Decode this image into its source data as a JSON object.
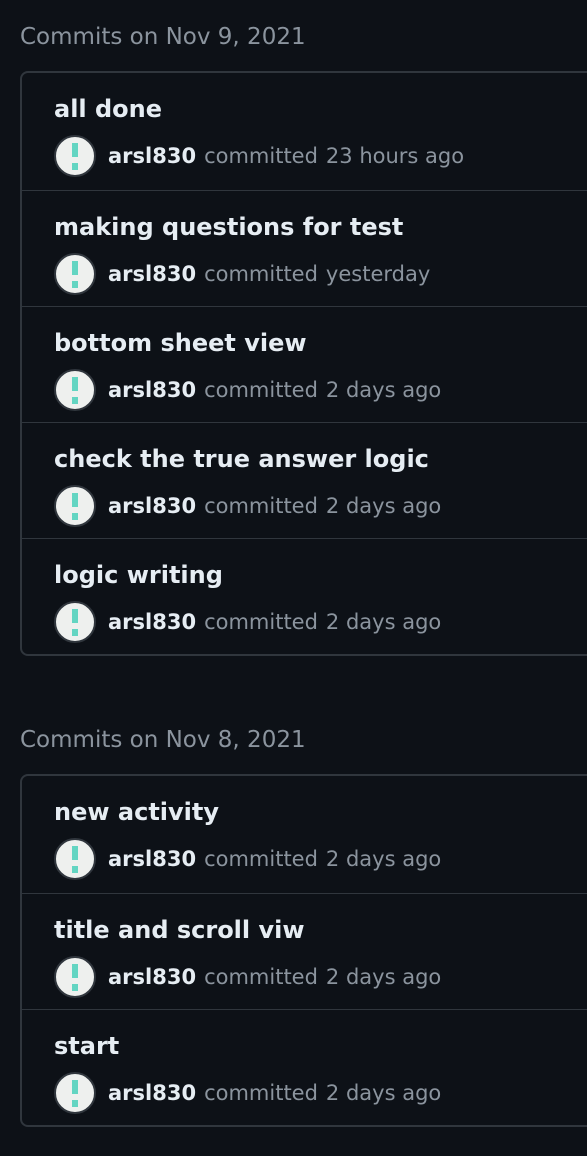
{
  "groups": [
    {
      "header": "Commits on Nov 9, 2021",
      "commits": [
        {
          "title": "all done",
          "author": "arsl830",
          "action": "committed",
          "time": "23 hours ago"
        },
        {
          "title": "making questions for test",
          "author": "arsl830",
          "action": "committed",
          "time": "yesterday"
        },
        {
          "title": "bottom sheet view",
          "author": "arsl830",
          "action": "committed",
          "time": "2 days ago"
        },
        {
          "title": "check the true answer logic",
          "author": "arsl830",
          "action": "committed",
          "time": "2 days ago"
        },
        {
          "title": "logic writing",
          "author": "arsl830",
          "action": "committed",
          "time": "2 days ago"
        }
      ]
    },
    {
      "header": "Commits on Nov 8, 2021",
      "commits": [
        {
          "title": "new activity",
          "author": "arsl830",
          "action": "committed",
          "time": "2 days ago"
        },
        {
          "title": "title and scroll viw",
          "author": "arsl830",
          "action": "committed",
          "time": "2 days ago"
        },
        {
          "title": "start",
          "author": "arsl830",
          "action": "committed",
          "time": "2 days ago"
        }
      ]
    }
  ],
  "avatar_icon": "identicon-avatar-icon",
  "colors": {
    "background": "#0d1117",
    "border": "#30363d",
    "title": "#e6edf3",
    "muted": "#8b949e",
    "identicon": "#63d5c2"
  }
}
